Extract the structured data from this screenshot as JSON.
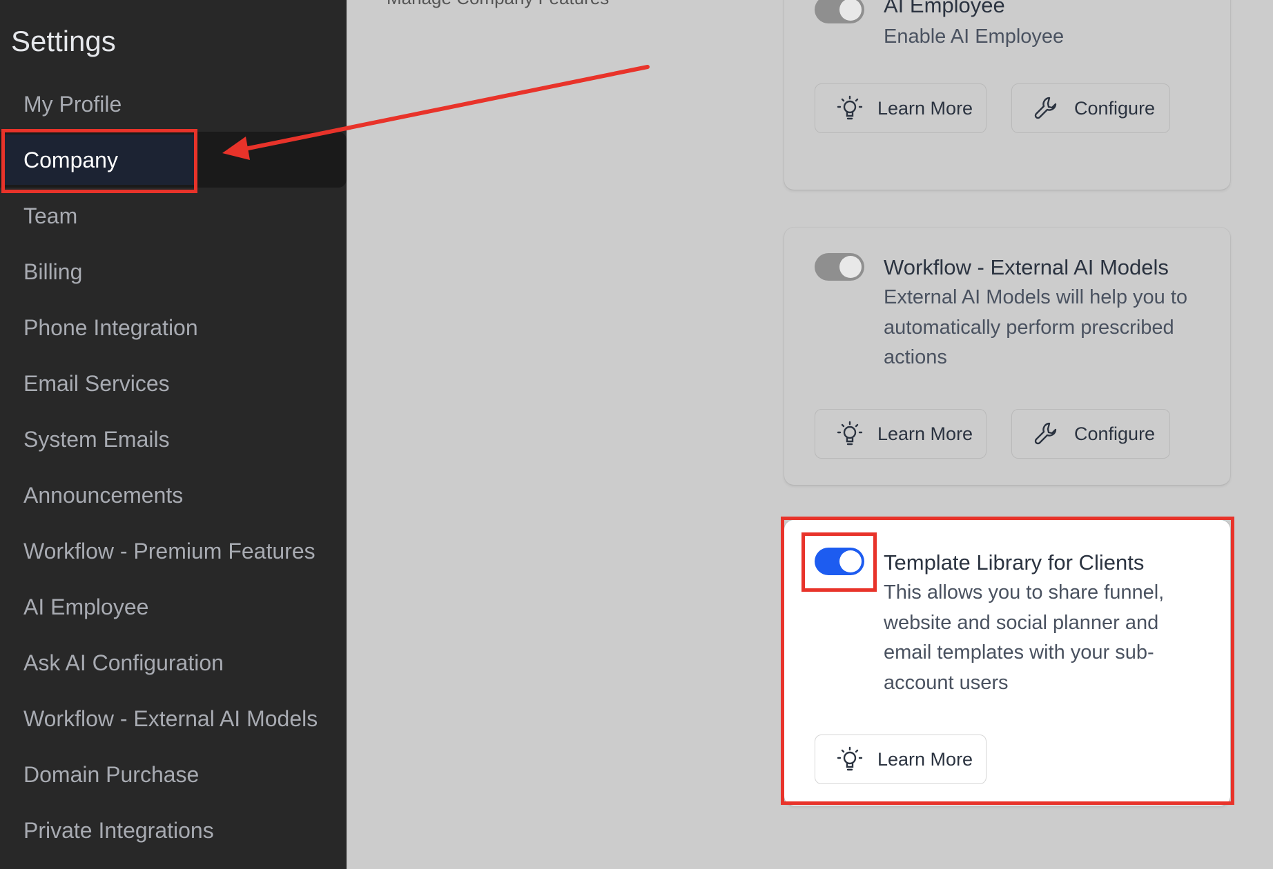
{
  "sidebar": {
    "title": "Settings",
    "items": [
      {
        "label": "My Profile",
        "active": false
      },
      {
        "label": "Company",
        "active": true
      },
      {
        "label": "Team",
        "active": false
      },
      {
        "label": "Billing",
        "active": false
      },
      {
        "label": "Phone Integration",
        "active": false
      },
      {
        "label": "Email Services",
        "active": false
      },
      {
        "label": "System Emails",
        "active": false
      },
      {
        "label": "Announcements",
        "active": false
      },
      {
        "label": "Workflow - Premium Features",
        "active": false
      },
      {
        "label": "AI Employee",
        "active": false
      },
      {
        "label": "Ask AI Configuration",
        "active": false
      },
      {
        "label": "Workflow - External AI Models",
        "active": false
      },
      {
        "label": "Domain Purchase",
        "active": false
      },
      {
        "label": "Private Integrations",
        "active": false
      }
    ]
  },
  "main": {
    "subtitle": "Manage Company Features"
  },
  "cards": [
    {
      "title": "AI Employee",
      "description": "Enable AI Employee",
      "enabled": false,
      "learn_more_label": "Learn More",
      "configure_label": "Configure"
    },
    {
      "title": "Workflow - External AI Models",
      "description": "External AI Models will help you to automatically perform prescribed actions",
      "enabled": false,
      "learn_more_label": "Learn More",
      "configure_label": "Configure"
    },
    {
      "title": "Template Library for Clients",
      "description": "This allows you to share funnel, website and social planner and email templates with your sub-account users",
      "enabled": true,
      "learn_more_label": "Learn More"
    }
  ],
  "icons": {
    "learn_more": "lightbulb-icon",
    "configure": "wrench-icon"
  },
  "colors": {
    "annotation": "#e8332a",
    "toggle_on": "#1d5cf0",
    "sidebar_bg": "#282828"
  }
}
